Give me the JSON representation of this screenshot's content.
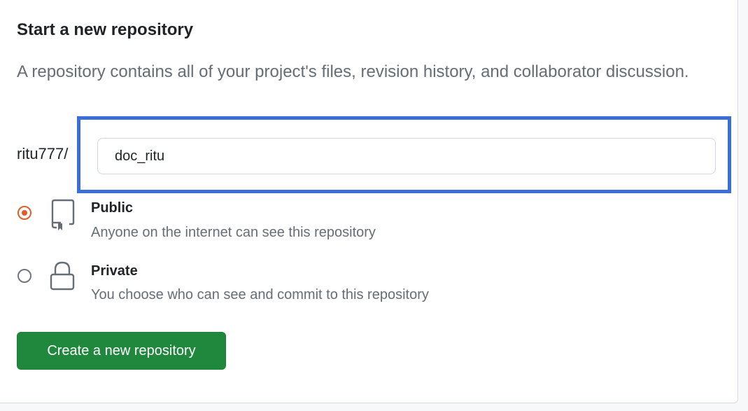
{
  "section": {
    "title": "Start a new repository",
    "description": "A repository contains all of your project's files, revision history, and collaborator discussion."
  },
  "repo_name": {
    "owner": "ritu777",
    "separator": "/",
    "value": "doc_ritu"
  },
  "visibility": {
    "selected": "Public",
    "options": [
      {
        "label": "Public",
        "description": "Anyone on the internet can see this repository",
        "icon": "repo-icon",
        "checked": true
      },
      {
        "label": "Private",
        "description": "You choose who can see and commit to this repository",
        "icon": "lock-icon",
        "checked": false
      }
    ]
  },
  "actions": {
    "create_label": "Create a new repository"
  },
  "colors": {
    "accent_radio": "#e05d2a",
    "primary_button": "#1f883d",
    "highlight_box": "#3b6fd8"
  }
}
